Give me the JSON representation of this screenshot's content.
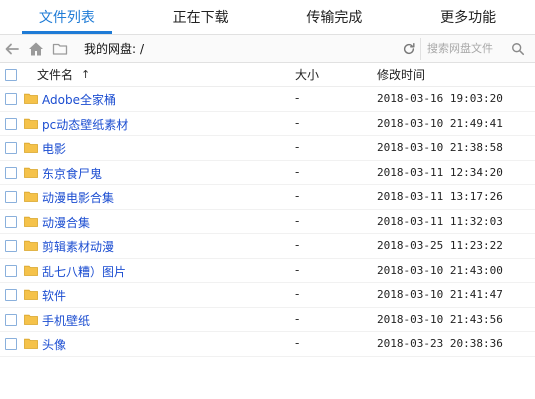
{
  "tabs": [
    {
      "label": "文件列表",
      "active": true
    },
    {
      "label": "正在下载",
      "active": false
    },
    {
      "label": "传输完成",
      "active": false
    },
    {
      "label": "更多功能",
      "active": false
    }
  ],
  "toolbar": {
    "back_icon": "back-arrow-icon",
    "home_icon": "home-icon",
    "folder_icon": "folder-icon",
    "location_label": "我的网盘:",
    "path": "/",
    "refresh_icon": "refresh-icon",
    "search_placeholder": "搜索网盘文件",
    "search_icon": "search-icon"
  },
  "table": {
    "headers": {
      "name": "文件名",
      "size": "大小",
      "time": "修改时间"
    },
    "sort_indicator": "↑",
    "rows": [
      {
        "name": "Adobe全家桶",
        "size": "-",
        "time": "2018-03-16 19:03:20"
      },
      {
        "name": "pc动态壁纸素材",
        "size": "-",
        "time": "2018-03-10 21:49:41"
      },
      {
        "name": "电影",
        "size": "-",
        "time": "2018-03-10 21:38:58"
      },
      {
        "name": "东京食尸鬼",
        "size": "-",
        "time": "2018-03-11 12:34:20"
      },
      {
        "name": "动漫电影合集",
        "size": "-",
        "time": "2018-03-11 13:17:26"
      },
      {
        "name": "动漫合集",
        "size": "-",
        "time": "2018-03-11 11:32:03"
      },
      {
        "name": "剪辑素材动漫",
        "size": "-",
        "time": "2018-03-25 11:23:22"
      },
      {
        "name": "乱七八糟）图片",
        "size": "-",
        "time": "2018-03-10 21:43:00"
      },
      {
        "name": "软件",
        "size": "-",
        "time": "2018-03-10 21:41:47"
      },
      {
        "name": "手机壁纸",
        "size": "-",
        "time": "2018-03-10 21:43:56"
      },
      {
        "name": "头像",
        "size": "-",
        "time": "2018-03-23 20:38:36"
      }
    ]
  },
  "colors": {
    "accent": "#1e7bd6",
    "link": "#1b4dd1",
    "folder": "#f5c24a"
  }
}
